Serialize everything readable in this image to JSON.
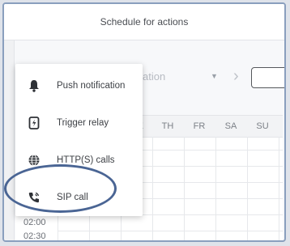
{
  "dialog": {
    "title": "Schedule for actions"
  },
  "controls": {
    "event_select_value": "fication",
    "next_icon": "chevron-right-icon"
  },
  "calendar": {
    "days": [
      "WE",
      "TH",
      "FR",
      "SA",
      "SU"
    ],
    "time_labels": [
      "02:00",
      "02:30"
    ]
  },
  "menu": {
    "items": [
      {
        "label": "Push notification",
        "icon": "bell-icon"
      },
      {
        "label": "Trigger relay",
        "icon": "relay-icon"
      },
      {
        "label": "HTTP(S) calls",
        "icon": "globe-icon"
      },
      {
        "label": "SIP call",
        "icon": "phone-icon"
      }
    ]
  },
  "colors": {
    "highlight_ring": "#4a6594",
    "frame_border": "#8a9fbe"
  }
}
